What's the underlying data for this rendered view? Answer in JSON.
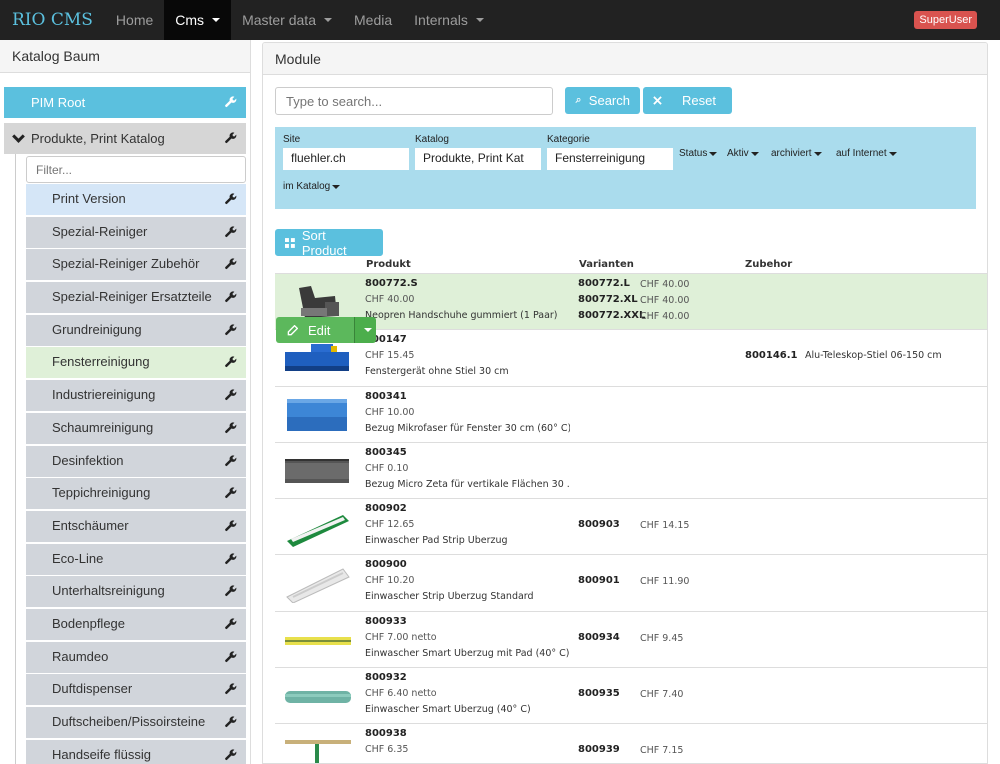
{
  "navbar": {
    "brand": "RIO CMS",
    "items": [
      {
        "label": "Home",
        "dropdown": false,
        "active": false
      },
      {
        "label": "Cms",
        "dropdown": true,
        "active": true
      },
      {
        "label": "Master data",
        "dropdown": true,
        "active": false
      },
      {
        "label": "Media",
        "dropdown": false,
        "active": false
      },
      {
        "label": "Internals",
        "dropdown": true,
        "active": false
      }
    ],
    "user_badge": "SuperUser"
  },
  "sidebar": {
    "title": "Katalog Baum",
    "root_label": "PIM Root",
    "parent_label": "Produkte, Print Katalog",
    "filter_placeholder": "Filter...",
    "children": [
      "Print Version",
      "Spezial-Reiniger",
      "Spezial-Reiniger Zubehör",
      "Spezial-Reiniger Ersatzteile",
      "Grundreinigung",
      "Fensterreinigung",
      "Industriereinigung",
      "Schaumreinigung",
      "Desinfektion",
      "Teppichreinigung",
      "Entschäumer",
      "Eco-Line",
      "Unterhaltsreinigung",
      "Bodenpflege",
      "Raumdeo",
      "Duftdispenser",
      "Duftscheiben/Pissoirsteine",
      "Handseife flüssig"
    ],
    "selected": "Fensterreinigung"
  },
  "main": {
    "title": "Module",
    "search_placeholder": "Type to search...",
    "search_button": "Search",
    "reset_button": "Reset",
    "filters": {
      "site_label": "Site",
      "site_value": "fluehler.ch",
      "katalog_label": "Katalog",
      "katalog_value": "Produkte, Print Kat",
      "kategorie_label": "Kategorie",
      "kategorie_value": "Fensterreinigung",
      "status": "Status",
      "aktiv": "Aktiv",
      "archiviert": "archiviert",
      "auf_internet": "auf Internet",
      "im_katalog": "im Katalog"
    },
    "sort_button": "Sort Product",
    "edit_button": "Edit",
    "columns": {
      "produkt": "Produkt",
      "varianten": "Varianten",
      "zubehor": "Zubehor"
    },
    "products": [
      {
        "code": "800772.S",
        "price": "CHF 40.00",
        "desc": "Neopren Handschuhe gummiert (1 Paar)",
        "thumb": "glove",
        "variants": [
          {
            "code": "800772.L",
            "price": "CHF 40.00"
          },
          {
            "code": "800772.XL",
            "price": "CHF 40.00"
          },
          {
            "code": "800772.XXL",
            "price": "CHF 40.00"
          }
        ],
        "accessories": []
      },
      {
        "code": "800147",
        "price": "CHF 15.45",
        "desc": "Fenstergerät ohne Stiel 30 cm",
        "thumb": "bluetool",
        "variants": [],
        "accessories": [
          {
            "code": "800146.1",
            "desc": "Alu-Teleskop-Stiel 06-150 cm"
          }
        ]
      },
      {
        "code": "800341",
        "price": "CHF 10.00",
        "desc": "Bezug Mikrofaser für Fenster 30 cm (60° C)",
        "thumb": "bluepad",
        "variants": [],
        "accessories": []
      },
      {
        "code": "800345",
        "price": "CHF 0.10",
        "desc": "Bezug Micro Zeta für vertikale Flächen 30 ...",
        "thumb": "greypad",
        "variants": [],
        "accessories": []
      },
      {
        "code": "800902",
        "price": "CHF 12.65",
        "desc": "Einwascher Pad Strip Überzug",
        "thumb": "greenstrip",
        "variants": [
          {
            "code": "800903",
            "price": "CHF 14.15"
          }
        ],
        "accessories": []
      },
      {
        "code": "800900",
        "price": "CHF 10.20",
        "desc": "Einwascher Strip Überzug Standard",
        "thumb": "whitestrip",
        "variants": [
          {
            "code": "800901",
            "price": "CHF 11.90"
          }
        ],
        "accessories": []
      },
      {
        "code": "800933",
        "price": "CHF 7.00 netto",
        "desc": "Einwascher Smart Überzug mit Pad (40° C)",
        "thumb": "yellowstrip",
        "variants": [
          {
            "code": "800934",
            "price": "CHF 9.45"
          }
        ],
        "accessories": []
      },
      {
        "code": "800932",
        "price": "CHF 6.40 netto",
        "desc": "Einwascher Smart Überzug (40° C)",
        "thumb": "tealstrip",
        "variants": [
          {
            "code": "800935",
            "price": "CHF 7.40"
          }
        ],
        "accessories": []
      },
      {
        "code": "800938",
        "price": "CHF 6.35",
        "desc": "",
        "thumb": "squeegee",
        "variants": [
          {
            "code": "800939",
            "price": "CHF 7.15"
          }
        ],
        "accessories": []
      }
    ]
  },
  "colors": {
    "info": "#5bc0de",
    "success": "#5cb85c",
    "danger": "#d9534f",
    "navbar": "#222222",
    "highlight": "#dff0d8"
  }
}
